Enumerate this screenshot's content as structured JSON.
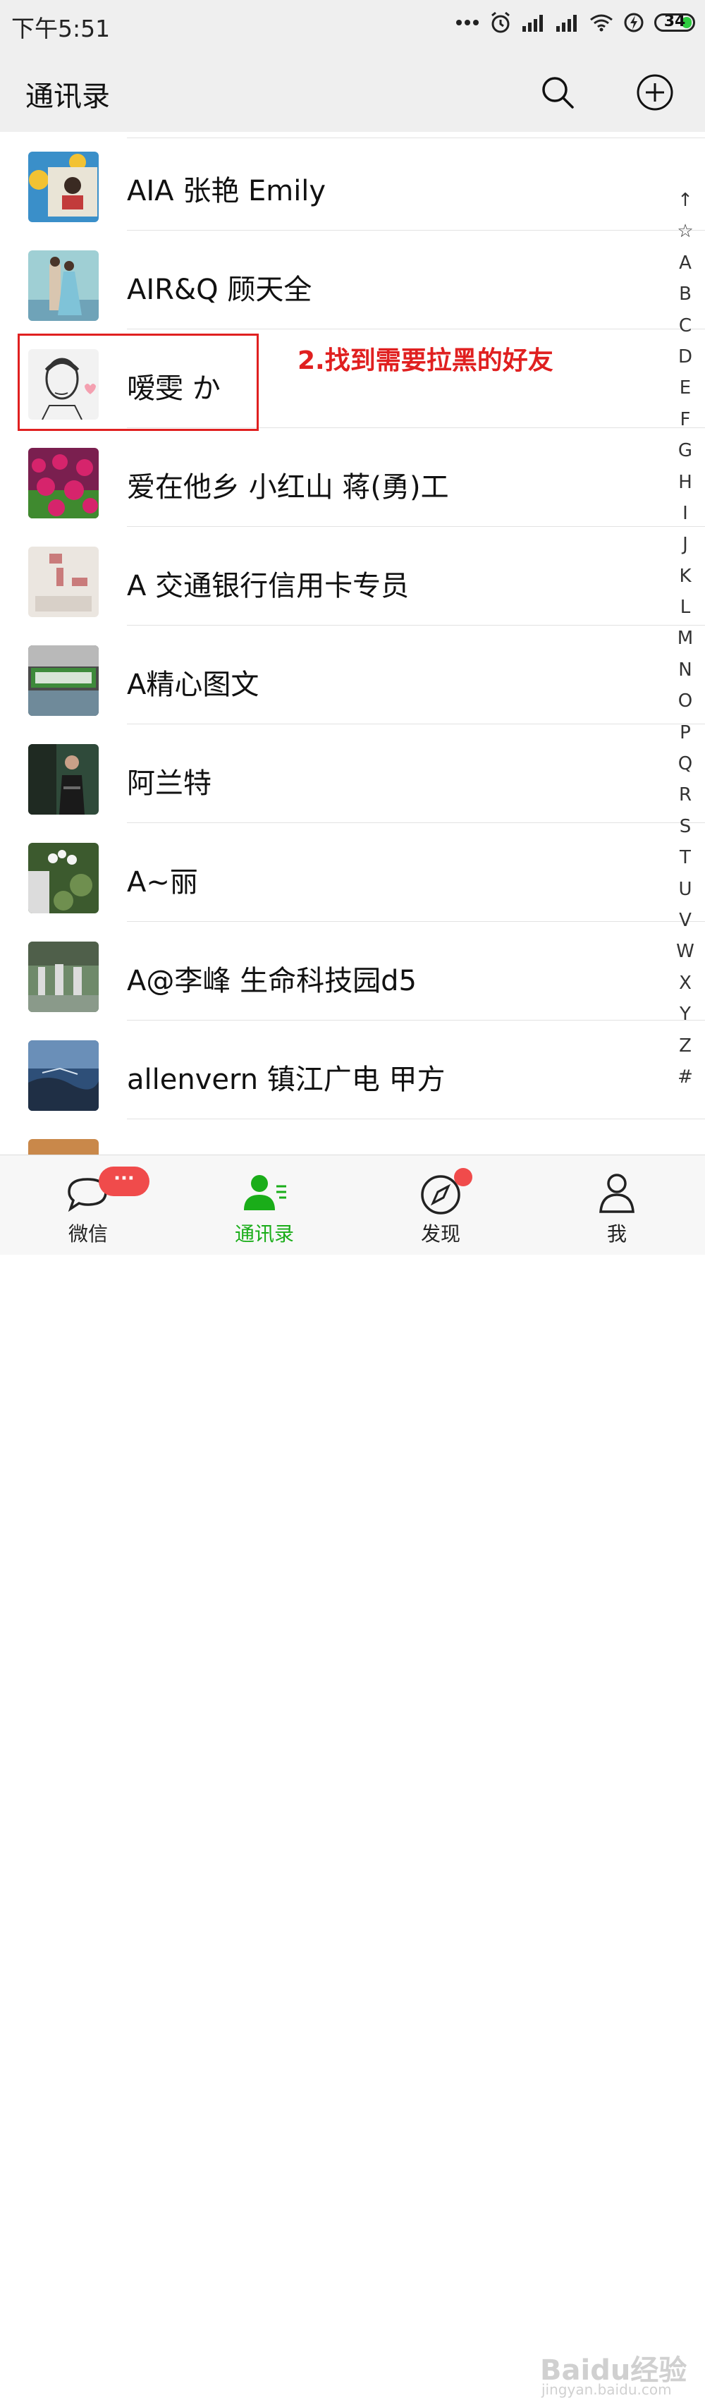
{
  "status_bar": {
    "time": "下午5:51",
    "battery_level": "34",
    "icons": [
      "more-dots-icon",
      "alarm-icon",
      "signal-icon",
      "signal-icon",
      "wifi-icon",
      "charging-icon",
      "battery-icon"
    ]
  },
  "header": {
    "title": "通讯录",
    "search_icon": "search-icon",
    "add_icon": "add-circle-icon"
  },
  "contacts": [
    {
      "name": "AIA 张艳 Emily",
      "avatar_colors": [
        "#3a8fc9",
        "#f2c233",
        "#e9e4d6"
      ]
    },
    {
      "name": "AIR&Q 顾天全",
      "avatar_colors": [
        "#9fcfd4",
        "#d9c6b0",
        "#6fa3b8"
      ]
    },
    {
      "name": "嗳雯 か",
      "avatar_colors": [
        "#f2f2f2",
        "#e6e6e6",
        "#333333"
      ]
    },
    {
      "name": "爱在他乡 小红山 蒋(勇)工",
      "avatar_colors": [
        "#d6246c",
        "#7a1f4f",
        "#3f8a2f"
      ]
    },
    {
      "name": "A 交通银行信用卡专员",
      "avatar_colors": [
        "#ebe6e0",
        "#c97b7b",
        "#d8d0c8"
      ]
    },
    {
      "name": "A精心图文",
      "avatar_colors": [
        "#3e8a3b",
        "#f3f3f3",
        "#4a4a4a"
      ]
    },
    {
      "name": "阿兰特",
      "avatar_colors": [
        "#2f4a3a",
        "#1f2a22",
        "#6a6a6a"
      ]
    },
    {
      "name": "A~丽",
      "avatar_colors": [
        "#3c5a2e",
        "#f4f4f4",
        "#6f8f4f"
      ]
    },
    {
      "name": "A@李峰 生命科技园d5",
      "avatar_colors": [
        "#6f8a6a",
        "#dcdcdc",
        "#4f5f4a"
      ]
    },
    {
      "name": "allenvern 镇江广电 甲方",
      "avatar_colors": [
        "#2e4f78",
        "#6a8fb8",
        "#1f2f45"
      ]
    }
  ],
  "annotation": {
    "text": "2.找到需要拉黑的好友",
    "color": "#e02020"
  },
  "index_bar": [
    "↑",
    "☆",
    "A",
    "B",
    "C",
    "D",
    "E",
    "F",
    "G",
    "H",
    "I",
    "J",
    "K",
    "L",
    "M",
    "N",
    "O",
    "P",
    "Q",
    "R",
    "S",
    "T",
    "U",
    "V",
    "W",
    "X",
    "Y",
    "Z",
    "#"
  ],
  "bottom_nav": {
    "items": [
      {
        "label": "微信",
        "icon": "chat-bubble-icon",
        "active": false,
        "badge": "···"
      },
      {
        "label": "通讯录",
        "icon": "contacts-icon",
        "active": true
      },
      {
        "label": "发现",
        "icon": "compass-icon",
        "active": false,
        "badge_dot": true
      },
      {
        "label": "我",
        "icon": "person-icon",
        "active": false
      }
    ],
    "active_color": "#1aad19"
  },
  "watermark": {
    "text": "Baidu经验",
    "sub": "jingyan.baidu.com"
  }
}
